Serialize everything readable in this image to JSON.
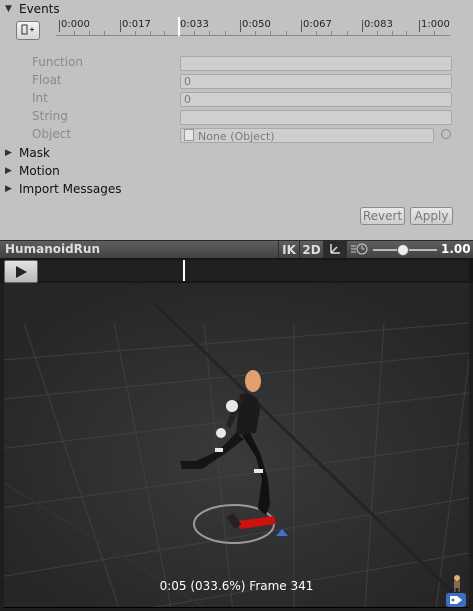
{
  "events": {
    "title": "Events",
    "add_button_icon": "add-event-icon",
    "timeline_ticks": [
      "0:000",
      "0:017",
      "0:033",
      "0:050",
      "0:067",
      "0:083",
      "1:000"
    ]
  },
  "fields": {
    "function": {
      "label": "Function",
      "value": ""
    },
    "float": {
      "label": "Float",
      "value": "0"
    },
    "int": {
      "label": "Int",
      "value": "0"
    },
    "string": {
      "label": "String",
      "value": ""
    },
    "object": {
      "label": "Object",
      "value": "None (Object)"
    }
  },
  "foldouts": {
    "mask": "Mask",
    "motion": "Motion",
    "import_messages": "Import Messages"
  },
  "buttons": {
    "revert": "Revert",
    "apply": "Apply"
  },
  "preview": {
    "title": "HumanoidRun",
    "ik_label": "IK",
    "mode_label": "2D",
    "speed_value": "1.00",
    "speed_level": 0.45,
    "frame_readout": "0:05 (033.6%) Frame 341",
    "playhead_fraction": 0.336
  },
  "colors": {
    "inspector_bg": "#c2c2c2",
    "viewport_bg": "#2e2e2e",
    "forward_arrow": "#cc1111",
    "up_marker": "#3d6fd6"
  }
}
